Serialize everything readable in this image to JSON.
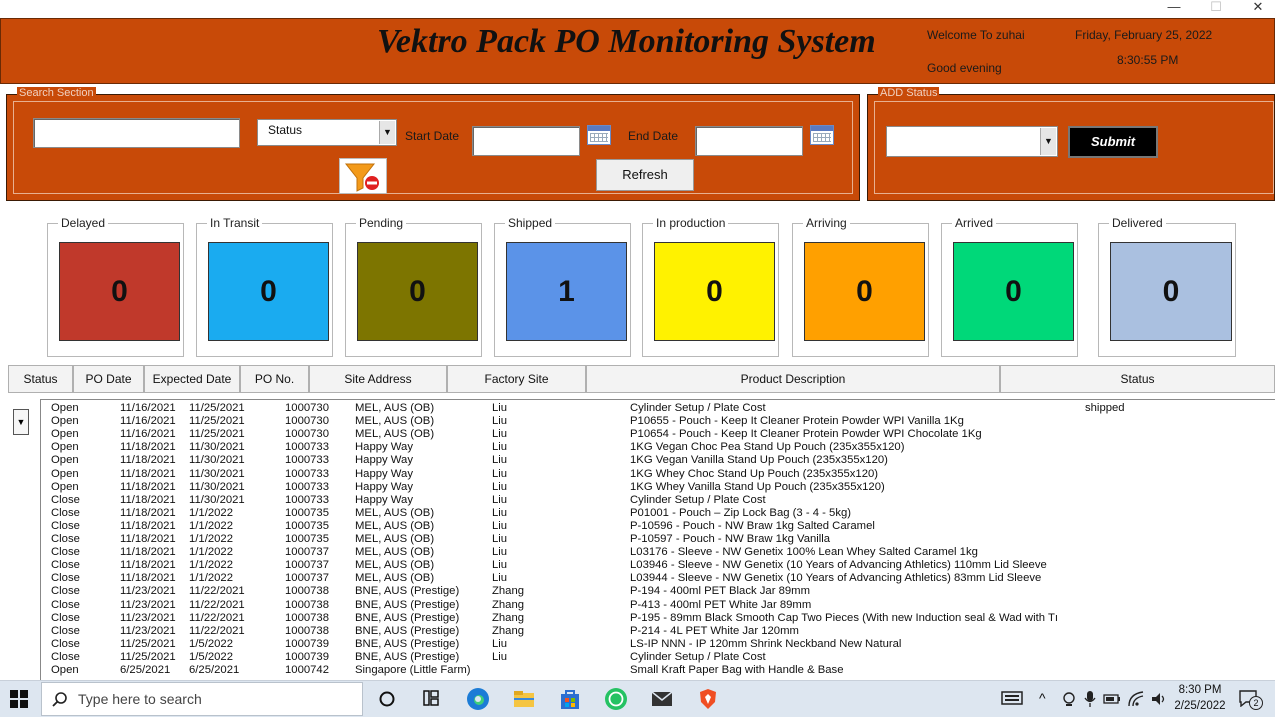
{
  "window": {
    "minimize": "—",
    "maximize": "☐",
    "close": "✕"
  },
  "header": {
    "title": "Vektro Pack PO Monitoring System",
    "welcome": "Welcome To zuhai",
    "greeting": "Good evening",
    "date": "Friday, February 25, 2022",
    "time": "8:30:55 PM"
  },
  "search": {
    "section_label": "Search Section",
    "search_value": "",
    "status_combo": "Status",
    "start_date_label": "Start Date",
    "end_date_label": "End Date",
    "start_date_value": "",
    "end_date_value": "",
    "refresh_label": "Refresh"
  },
  "add_status": {
    "section_label": "ADD Status",
    "combo_value": "",
    "submit_label": "Submit"
  },
  "cards": [
    {
      "label": "Delayed",
      "count": "0",
      "color": "#c0392b"
    },
    {
      "label": "In Transit",
      "count": "0",
      "color": "#1aabf0"
    },
    {
      "label": "Pending",
      "count": "0",
      "color": "#7d7500"
    },
    {
      "label": "Shipped",
      "count": "1",
      "color": "#5b93e8"
    },
    {
      "label": "In production",
      "count": "0",
      "color": "#fff200"
    },
    {
      "label": "Arriving",
      "count": "0",
      "color": "#ffa000"
    },
    {
      "label": "Arrived",
      "count": "0",
      "color": "#00d879"
    },
    {
      "label": "Delivered",
      "count": "0",
      "color": "#aac0e0"
    }
  ],
  "columns": [
    "Status",
    "PO Date",
    "Expected Date",
    "PO No.",
    "Site Address",
    "Factory Site",
    "Product Description",
    "Status"
  ],
  "rows": [
    [
      "Open",
      "11/16/2021",
      "11/25/2021",
      "1000730",
      "MEL, AUS (OB)",
      "Liu",
      "Cylinder Setup / Plate Cost",
      "shipped"
    ],
    [
      "Open",
      "11/16/2021",
      "11/25/2021",
      "1000730",
      "MEL, AUS (OB)",
      "Liu",
      "P10655 - Pouch - Keep It Cleaner Protein Powder WPI Vanilla 1Kg",
      ""
    ],
    [
      "Open",
      "11/16/2021",
      "11/25/2021",
      "1000730",
      "MEL, AUS (OB)",
      "Liu",
      "P10654 - Pouch - Keep It Cleaner Protein Powder WPI Chocolate 1Kg",
      ""
    ],
    [
      "Open",
      "11/18/2021",
      "11/30/2021",
      "1000733",
      "Happy Way",
      "Liu",
      "1KG Vegan Choc Pea Stand Up Pouch (235x355x120)",
      ""
    ],
    [
      "Open",
      "11/18/2021",
      "11/30/2021",
      "1000733",
      "Happy Way",
      "Liu",
      "1KG Vegan Vanilla Stand Up Pouch (235x355x120)",
      ""
    ],
    [
      "Open",
      "11/18/2021",
      "11/30/2021",
      "1000733",
      "Happy Way",
      "Liu",
      "1KG Whey Choc Stand Up Pouch (235x355x120)",
      ""
    ],
    [
      "Open",
      "11/18/2021",
      "11/30/2021",
      "1000733",
      "Happy Way",
      "Liu",
      "1KG Whey Vanilla Stand Up Pouch (235x355x120)",
      ""
    ],
    [
      "Close",
      "11/18/2021",
      "11/30/2021",
      "1000733",
      "Happy Way",
      "Liu",
      "Cylinder Setup / Plate Cost",
      ""
    ],
    [
      "Close",
      "11/18/2021",
      "1/1/2022",
      "1000735",
      "MEL, AUS (OB)",
      "Liu",
      "P01001 - Pouch – Zip Lock Bag (3 - 4 - 5kg)",
      ""
    ],
    [
      "Close",
      "11/18/2021",
      "1/1/2022",
      "1000735",
      "MEL, AUS (OB)",
      "Liu",
      "P-10596 - Pouch - NW Braw 1kg Salted Caramel",
      ""
    ],
    [
      "Close",
      "11/18/2021",
      "1/1/2022",
      "1000735",
      "MEL, AUS (OB)",
      "Liu",
      "P-10597 - Pouch - NW Braw 1kg Vanilla",
      ""
    ],
    [
      "Close",
      "11/18/2021",
      "1/1/2022",
      "1000737",
      "MEL, AUS (OB)",
      "Liu",
      "L03176 - Sleeve - NW Genetix 100% Lean Whey Salted Caramel 1kg",
      ""
    ],
    [
      "Close",
      "11/18/2021",
      "1/1/2022",
      "1000737",
      "MEL, AUS (OB)",
      "Liu",
      "L03946 - Sleeve - NW Genetix (10 Years of Advancing Athletics) 110mm Lid Sleeve",
      ""
    ],
    [
      "Close",
      "11/18/2021",
      "1/1/2022",
      "1000737",
      "MEL, AUS (OB)",
      "Liu",
      "L03944 - Sleeve - NW Genetix (10 Years of Advancing Athletics) 83mm Lid Sleeve",
      ""
    ],
    [
      "Close",
      "11/23/2021",
      "11/22/2021",
      "1000738",
      "BNE, AUS (Prestige)",
      "Zhang",
      "P-194 - 400ml PET Black Jar 89mm",
      ""
    ],
    [
      "Close",
      "11/23/2021",
      "11/22/2021",
      "1000738",
      "BNE, AUS (Prestige)",
      "Zhang",
      "P-413 - 400ml PET White Jar 89mm",
      ""
    ],
    [
      "Close",
      "11/23/2021",
      "11/22/2021",
      "1000738",
      "BNE, AUS (Prestige)",
      "Zhang",
      "P-195 - 89mm Black Smooth Cap Two Pieces (With new Induction seal & Wad with Tı",
      ""
    ],
    [
      "Close",
      "11/23/2021",
      "11/22/2021",
      "1000738",
      "BNE, AUS (Prestige)",
      "Zhang",
      "P-214 - 4L PET White Jar 120mm",
      ""
    ],
    [
      "Close",
      "11/25/2021",
      "1/5/2022",
      "1000739",
      "BNE, AUS (Prestige)",
      "Liu",
      "LS-IP NNN - IP 120mm Shrink Neckband New Natural",
      ""
    ],
    [
      "Close",
      "11/25/2021",
      "1/5/2022",
      "1000739",
      "BNE, AUS (Prestige)",
      "Liu",
      "Cylinder Setup / Plate Cost",
      ""
    ],
    [
      "Open",
      "6/25/2021",
      "6/25/2021",
      "1000742",
      "Singapore (Little Farm)",
      "",
      "Small Kraft Paper Bag with Handle & Base",
      ""
    ]
  ],
  "taskbar": {
    "search_placeholder": "Type here to search",
    "time": "8:30 PM",
    "date": "2/25/2022",
    "notification_count": "2"
  }
}
